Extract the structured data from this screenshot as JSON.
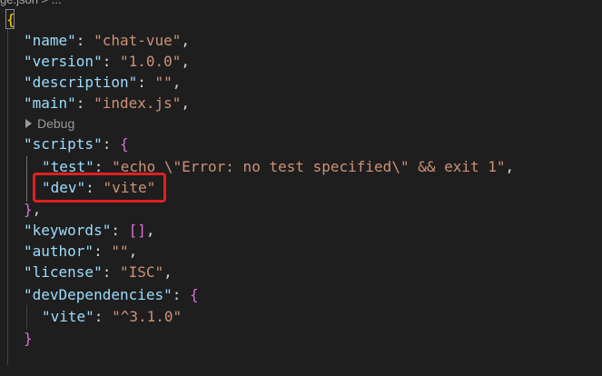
{
  "breadcrumb": {
    "text": "ge.json > ..."
  },
  "codelens": {
    "label": "Debug"
  },
  "code": {
    "open_brace": "{",
    "name_key": "\"name\"",
    "name_val": "\"chat-vue\"",
    "version_key": "\"version\"",
    "version_val": "\"1.0.0\"",
    "description_key": "\"description\"",
    "description_val": "\"\"",
    "main_key": "\"main\"",
    "main_val": "\"index.js\"",
    "scripts_key": "\"scripts\"",
    "scripts_open": "{",
    "test_key": "\"test\"",
    "test_val": "\"echo \\\"Error: no test specified\\\" && exit 1\"",
    "dev_key": "\"dev\"",
    "dev_val": "\"vite\"",
    "scripts_close": "}",
    "keywords_key": "\"keywords\"",
    "keywords_val": "[]",
    "author_key": "\"author\"",
    "author_val": "\"\"",
    "license_key": "\"license\"",
    "license_val": "\"ISC\"",
    "devdeps_key": "\"devDependencies\"",
    "devdeps_open": "{",
    "vite_key": "\"vite\"",
    "vite_val": "\"^3.1.0\"",
    "devdeps_close": "}"
  },
  "colors": {
    "background": "#1e1e1e",
    "key": "#9cdcfe",
    "string": "#ce9178",
    "highlight": "#e02020"
  }
}
